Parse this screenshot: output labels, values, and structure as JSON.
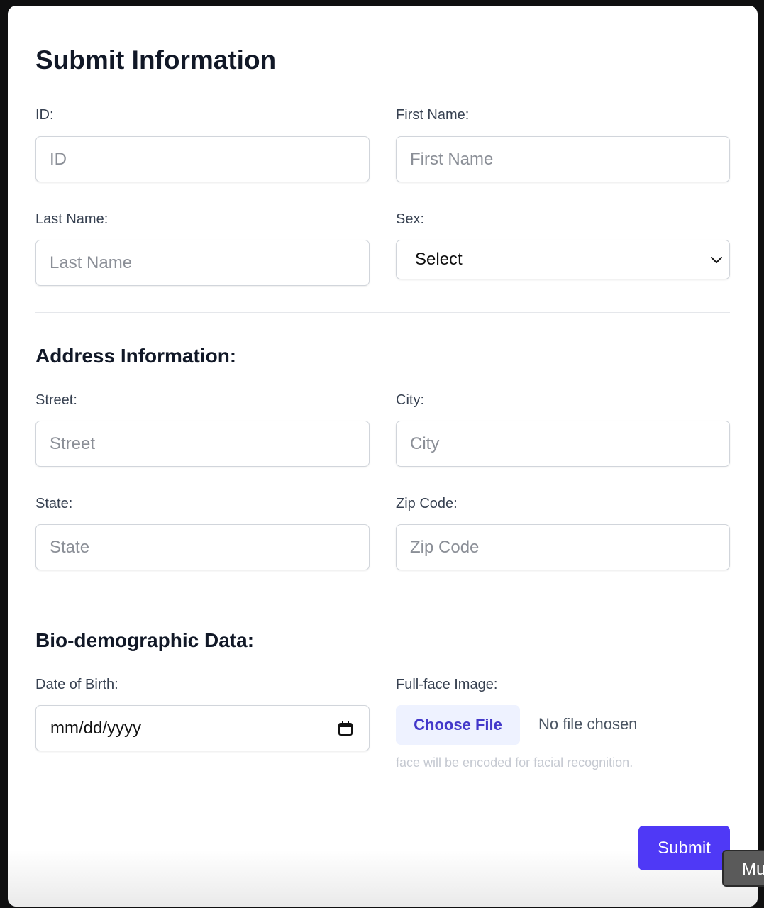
{
  "form": {
    "title": "Submit Information",
    "id": {
      "label": "ID:",
      "placeholder": "ID"
    },
    "first_name": {
      "label": "First Name:",
      "placeholder": "First Name"
    },
    "last_name": {
      "label": "Last Name:",
      "placeholder": "Last Name"
    },
    "sex": {
      "label": "Sex:",
      "selected": "Select"
    }
  },
  "address": {
    "title": "Address Information:",
    "street": {
      "label": "Street:",
      "placeholder": "Street"
    },
    "city": {
      "label": "City:",
      "placeholder": "City"
    },
    "state": {
      "label": "State:",
      "placeholder": "State"
    },
    "zip": {
      "label": "Zip Code:",
      "placeholder": "Zip Code"
    }
  },
  "bio": {
    "title": "Bio-demographic Data:",
    "dob": {
      "label": "Date of Birth:",
      "value": "mm/dd/yyyy"
    },
    "image": {
      "label": "Full-face Image:",
      "button": "Choose File",
      "status": "No file chosen",
      "hint": "face will be encoded for facial recognition."
    }
  },
  "actions": {
    "submit": "Submit"
  },
  "tooltip": {
    "text": "Mu"
  },
  "colors": {
    "accent": "#4f39f6",
    "file_button_bg": "#eef2ff",
    "file_button_text": "#4338ca",
    "heading": "#111827"
  },
  "icons": {
    "select": "chevron-down-icon",
    "date": "calendar-icon"
  }
}
